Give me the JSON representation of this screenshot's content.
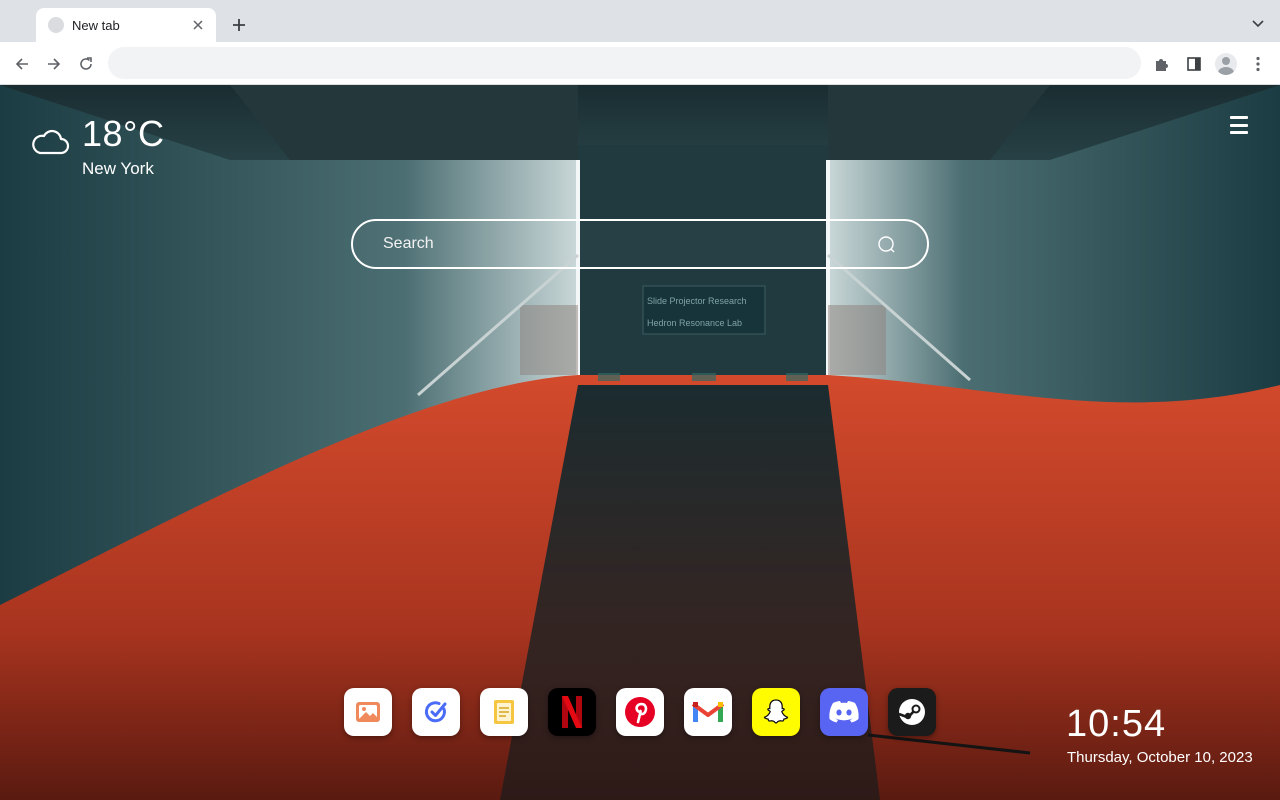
{
  "browser": {
    "tab": {
      "title": "New tab"
    },
    "omnibox": {
      "value": "",
      "placeholder": ""
    }
  },
  "weather": {
    "temperature": "18°C",
    "city": "New York",
    "icon": "cloud-icon"
  },
  "search": {
    "placeholder": "Search",
    "icon": "search-icon"
  },
  "signs": [
    "Slide Projector Research",
    "Hedron Resonance Lab"
  ],
  "shortcuts": [
    {
      "name": "Photos",
      "icon": "photos-icon",
      "color": "#ffffff"
    },
    {
      "name": "Tasks",
      "icon": "check-circle-icon",
      "color": "#ffffff"
    },
    {
      "name": "Notes",
      "icon": "notes-icon",
      "color": "#ffffff"
    },
    {
      "name": "Netflix",
      "icon": "netflix-icon",
      "color": "#000000"
    },
    {
      "name": "Pinterest",
      "icon": "pinterest-icon",
      "color": "#ffffff"
    },
    {
      "name": "Gmail",
      "icon": "gmail-icon",
      "color": "#ffffff"
    },
    {
      "name": "Snapchat",
      "icon": "snapchat-icon",
      "color": "#fffc00"
    },
    {
      "name": "Discord",
      "icon": "discord-icon",
      "color": "#5865f2"
    },
    {
      "name": "Steam",
      "icon": "steam-icon",
      "color": "#1b1b1b"
    }
  ],
  "clock": {
    "time": "10:54",
    "date": "Thursday, October 10, 2023"
  }
}
